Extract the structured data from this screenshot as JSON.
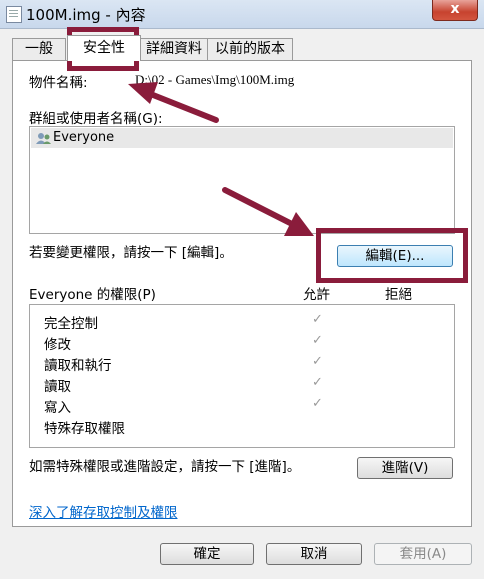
{
  "window": {
    "title": "100M.img - 內容",
    "close_label": "x"
  },
  "tabs": [
    {
      "label": "一般"
    },
    {
      "label": "安全性"
    },
    {
      "label": "詳細資料"
    },
    {
      "label": "以前的版本"
    }
  ],
  "security": {
    "object_name_label": "物件名稱:",
    "object_name_value": "D:\\02 - Games\\Img\\100M.img",
    "group_label": "群組或使用者名稱(G):",
    "users": [
      {
        "name": "Everyone"
      }
    ],
    "change_hint": "若要變更權限，請按一下 [編輯]。",
    "edit_button": "編輯(E)...",
    "perm_label": "Everyone 的權限(P)",
    "allow_header": "允許",
    "deny_header": "拒絕",
    "permissions": [
      {
        "name": "完全控制",
        "allow": "✓",
        "deny": ""
      },
      {
        "name": "修改",
        "allow": "✓",
        "deny": ""
      },
      {
        "name": "讀取和執行",
        "allow": "✓",
        "deny": ""
      },
      {
        "name": "讀取",
        "allow": "✓",
        "deny": ""
      },
      {
        "name": "寫入",
        "allow": "✓",
        "deny": ""
      },
      {
        "name": "特殊存取權限",
        "allow": "",
        "deny": ""
      }
    ],
    "advanced_hint": "如需特殊權限或進階設定，請按一下 [進階]。",
    "advanced_button": "進階(V)",
    "learn_link": "深入了解存取控制及權限"
  },
  "footer": {
    "ok_button": "確定",
    "cancel_button": "取消",
    "apply_button": "套用(A)"
  },
  "annotation_color": "#8a1c3b"
}
